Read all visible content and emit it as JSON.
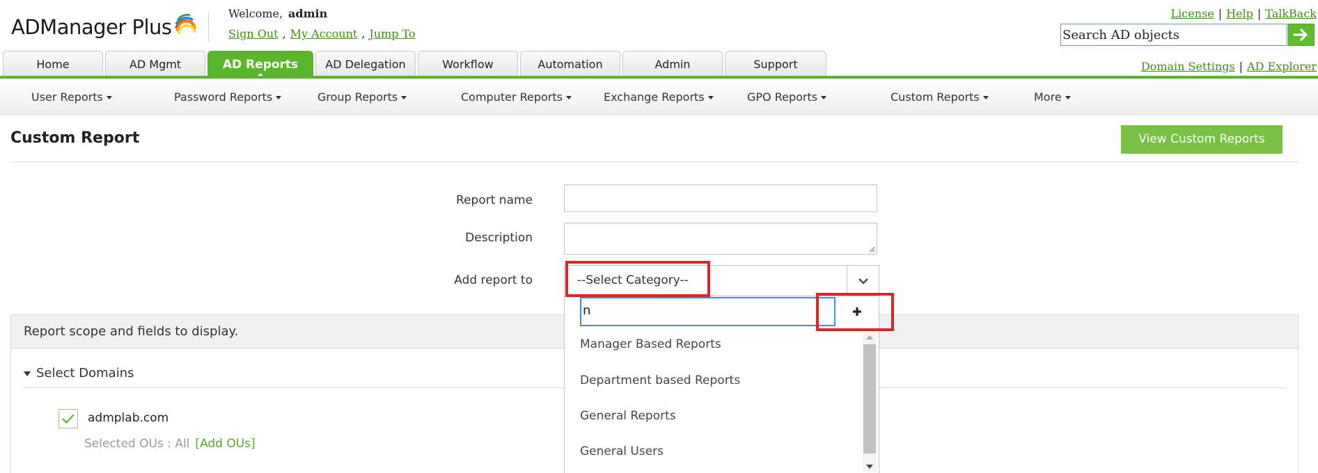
{
  "app": {
    "logo_text": "ADManager Plus",
    "welcome_label": "Welcome,",
    "username": "admin"
  },
  "user_links": {
    "sign_out": "Sign Out",
    "my_account": "My Account",
    "jump_to": "Jump To",
    "separator": ","
  },
  "top_right_links": [
    "License",
    "Help",
    "TalkBack"
  ],
  "top_right_separator": "|",
  "secondary_links": [
    "Domain Settings",
    "AD Explorer"
  ],
  "search": {
    "value": "Search AD objects",
    "button_icon": "arrow-right-icon"
  },
  "tabs": [
    {
      "label": "Home",
      "active": false
    },
    {
      "label": "AD Mgmt",
      "active": false
    },
    {
      "label": "AD Reports",
      "active": true
    },
    {
      "label": "AD Delegation",
      "active": false
    },
    {
      "label": "Workflow",
      "active": false
    },
    {
      "label": "Automation",
      "active": false
    },
    {
      "label": "Admin",
      "active": false
    },
    {
      "label": "Support",
      "active": false
    }
  ],
  "subnav": [
    "User Reports",
    "Password Reports",
    "Group Reports",
    "Computer Reports",
    "Exchange Reports",
    "GPO Reports",
    "Custom Reports",
    "More"
  ],
  "page": {
    "title": "Custom Report",
    "view_button": "View Custom Reports"
  },
  "form": {
    "report_name_label": "Report name",
    "report_name_value": "",
    "description_label": "Description",
    "description_value": "",
    "add_report_to_label": "Add report to",
    "category_selected": "--Select Category--"
  },
  "category_dropdown": {
    "search_value": "n",
    "add_icon": "plus-icon",
    "items": [
      "Manager Based Reports",
      "Department based Reports",
      "General Reports",
      "General Users"
    ]
  },
  "scope": {
    "header": "Report scope and fields to display.",
    "select_domains": "Select Domains",
    "domain": "admplab.com",
    "domain_checked": true,
    "selected_ous_label": "Selected OUs :",
    "selected_ous_value": "All",
    "add_ous": "[Add OUs]"
  },
  "colors": {
    "brand_green": "#59b52a",
    "button_green": "#78c144",
    "link_green": "#3e8c13",
    "highlight_red": "#d9262a",
    "focus_blue": "#3f8de0"
  }
}
